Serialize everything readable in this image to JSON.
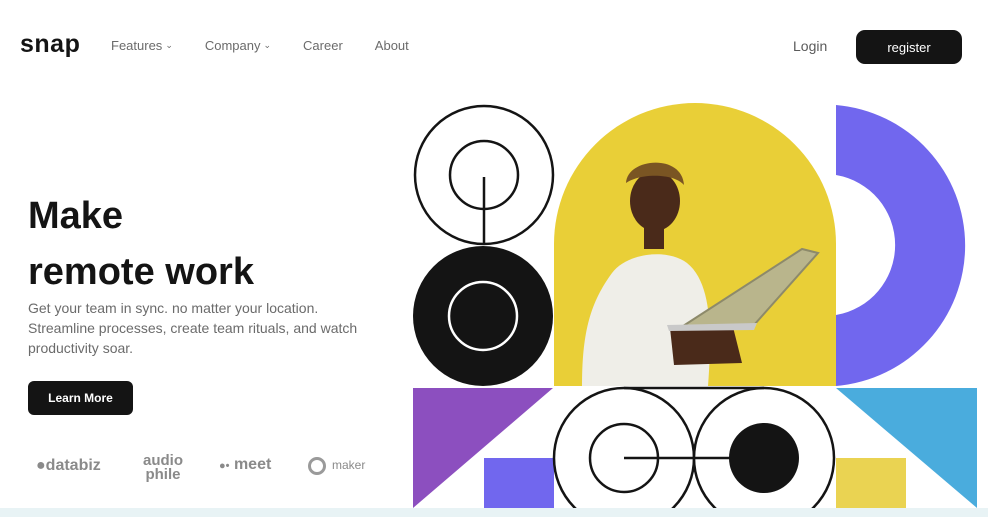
{
  "brand": {
    "logo": "snap"
  },
  "nav": {
    "links": [
      {
        "label": "Features",
        "has_dropdown": true
      },
      {
        "label": "Company",
        "has_dropdown": true
      },
      {
        "label": "Career",
        "has_dropdown": false
      },
      {
        "label": "About",
        "has_dropdown": false
      }
    ],
    "dropdown_icon": "chevron-down-icon",
    "login_label": "Login",
    "register_label": "register"
  },
  "hero": {
    "title_line1": "Make",
    "title_line2": "remote work",
    "description": "Get your team in sync. no matter your location. Streamline processes, create team rituals, and watch productivity soar.",
    "cta_label": "Learn More"
  },
  "clients": {
    "databiz": "databiz",
    "audiophile_top": "audio",
    "audiophile_bottom": "phile",
    "meet": "meet",
    "maker": "maker"
  },
  "colors": {
    "dark": "#141414",
    "yellow": "#e9cf37",
    "purple": "#7167ee",
    "violet": "#8c4fbf",
    "sky": "#4aacdd",
    "mustard": "#ead352"
  }
}
